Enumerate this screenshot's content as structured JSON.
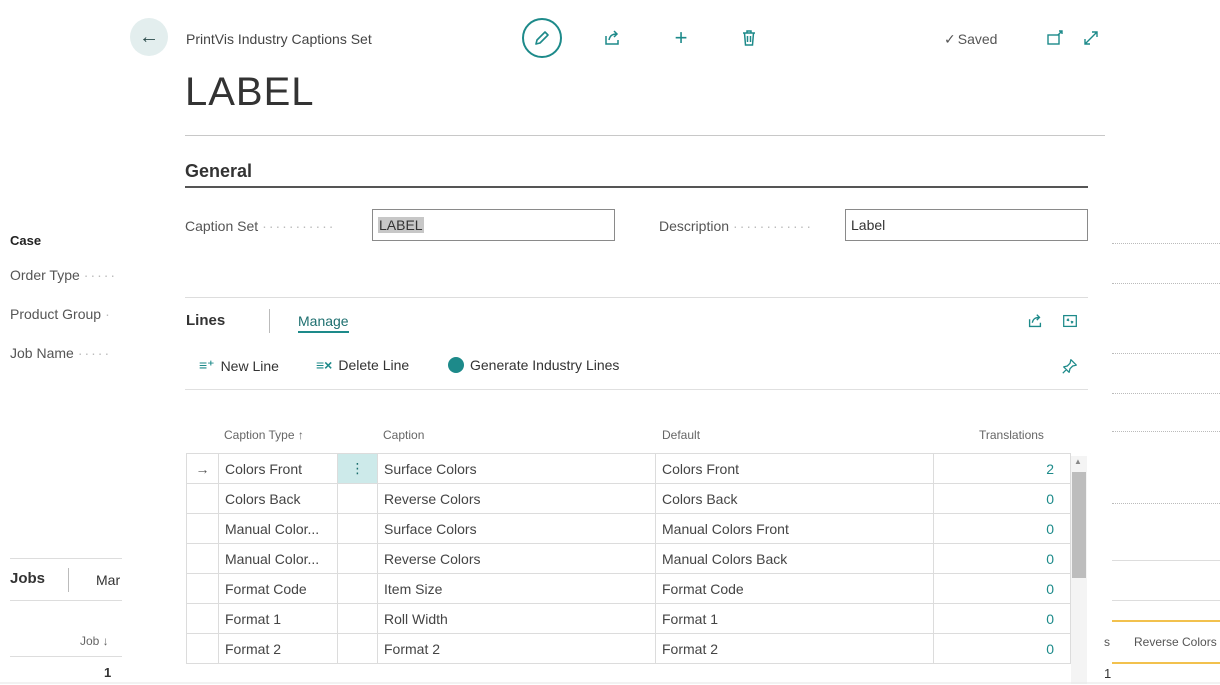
{
  "background": {
    "case_title": "Case",
    "fields": [
      "Order Type",
      "Product Group",
      "Job Name"
    ],
    "jobs": {
      "title": "Jobs",
      "manage": "Mar",
      "col_header": "Job ↓",
      "row_value": "1"
    },
    "right_col_header": "Reverse Colors",
    "right_col_prefix": "s",
    "right_col_value": "1"
  },
  "header": {
    "back_icon": "arrow-left-icon",
    "breadcrumb": "PrintVis Industry Captions Set",
    "title": "LABEL",
    "saved": "Saved",
    "toolbar_icons": [
      "pencil-icon",
      "share-icon",
      "plus-icon",
      "trash-icon",
      "open-new-window-icon",
      "expand-icon"
    ]
  },
  "general": {
    "title": "General",
    "caption_set_label": "Caption Set",
    "caption_set_value": "LABEL",
    "description_label": "Description",
    "description_value": "Label"
  },
  "lines": {
    "title": "Lines",
    "manage": "Manage",
    "actions": {
      "new_line": "New Line",
      "delete_line": "Delete Line",
      "generate": "Generate Industry Lines"
    },
    "columns": {
      "caption_type": "Caption Type ↑",
      "caption": "Caption",
      "default": "Default",
      "translations": "Translations"
    },
    "rows": [
      {
        "caption_type": "Colors Front",
        "caption": "Surface Colors",
        "default": "Colors Front",
        "translations": "2"
      },
      {
        "caption_type": "Colors Back",
        "caption": "Reverse Colors",
        "default": "Colors Back",
        "translations": "0"
      },
      {
        "caption_type": "Manual Color...",
        "caption": "Surface Colors",
        "default": "Manual Colors Front",
        "translations": "0"
      },
      {
        "caption_type": "Manual Color...",
        "caption": "Reverse Colors",
        "default": "Manual Colors Back",
        "translations": "0"
      },
      {
        "caption_type": "Format Code",
        "caption": "Item Size",
        "default": "Format Code",
        "translations": "0"
      },
      {
        "caption_type": "Format 1",
        "caption": "Roll Width",
        "default": "Format 1",
        "translations": "0"
      },
      {
        "caption_type": "Format 2",
        "caption": "Format 2",
        "default": "Format 2",
        "translations": "0"
      }
    ]
  },
  "colors": {
    "accent": "#1d8a8a",
    "highlight": "#f2c14e"
  }
}
